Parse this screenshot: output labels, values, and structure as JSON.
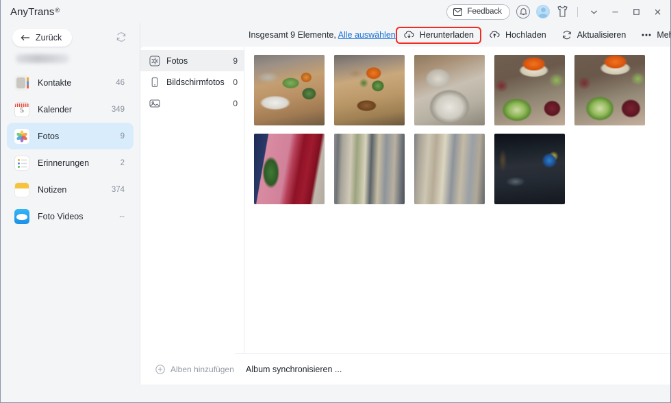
{
  "titlebar": {
    "brand": "AnyTrans",
    "registered_mark": "®",
    "feedback_label": "Feedback",
    "icons": {
      "envelope": "envelope-icon",
      "bell": "bell-icon",
      "avatar": "avatar",
      "shirt": "shirt-icon",
      "chevron": "chevron-down-icon",
      "minimize": "minimize-icon",
      "maximize": "maximize-icon",
      "close": "close-icon"
    }
  },
  "sidebar": {
    "back_label": "Zurück",
    "refresh_icon": "refresh-icon",
    "items": [
      {
        "label": "Kontakte",
        "count": "46",
        "icon": "contacts-icon"
      },
      {
        "label": "Kalender",
        "count": "349",
        "icon": "calendar-icon",
        "day": "5"
      },
      {
        "label": "Fotos",
        "count": "9",
        "icon": "photos-icon",
        "active": true
      },
      {
        "label": "Erinnerungen",
        "count": "2",
        "icon": "reminders-icon"
      },
      {
        "label": "Notizen",
        "count": "374",
        "icon": "notes-icon"
      },
      {
        "label": "Foto Videos",
        "count": "--",
        "icon": "photo-videos-icon"
      }
    ]
  },
  "middle": {
    "items": [
      {
        "label": "Fotos",
        "count": "9",
        "icon": "photos-grid-icon",
        "active": true
      },
      {
        "label": "Bildschirmfotos",
        "count": "0",
        "icon": "device-icon"
      },
      {
        "label": "",
        "count": "0",
        "icon": "image-icon"
      }
    ],
    "add_albums_label": "Alben hinzufügen"
  },
  "toolbar": {
    "total_prefix": "Insgesamt 9 Elemente,",
    "select_all_label": "Alle auswählen",
    "download_label": "Herunterladen",
    "upload_label": "Hochladen",
    "refresh_label": "Aktualisieren",
    "more_label": "Mehr",
    "grid_view_icon": "grid-view-icon",
    "list_view_icon": "list-view-icon",
    "highlight_color": "#f42a20"
  },
  "gallery": {
    "items": [
      {
        "name": "photo-meal-table-1"
      },
      {
        "name": "photo-meal-table-2"
      },
      {
        "name": "photo-bowls-closeup"
      },
      {
        "name": "photo-oranges-cups-1"
      },
      {
        "name": "photo-oranges-cups-2"
      },
      {
        "name": "photo-red-fridge-plants"
      },
      {
        "name": "photo-vending-machines-1"
      },
      {
        "name": "photo-vending-machines-2"
      },
      {
        "name": "photo-night-street"
      }
    ]
  },
  "statusbar": {
    "message": "Album synchronisieren ..."
  }
}
